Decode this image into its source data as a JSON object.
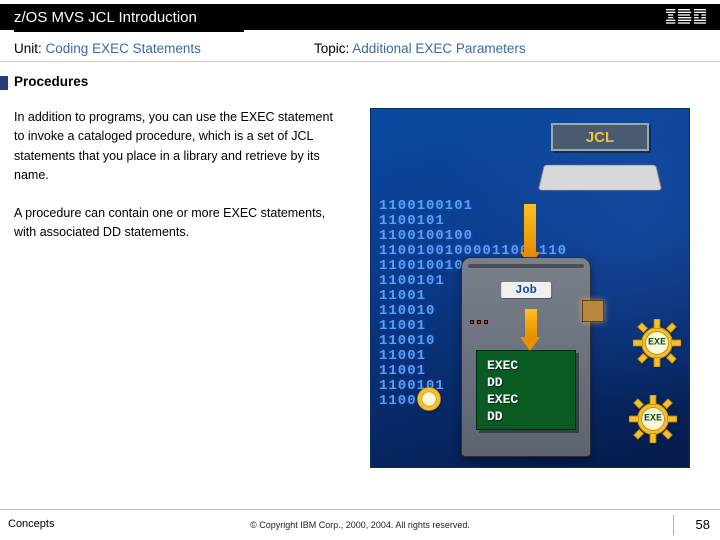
{
  "header": {
    "title": "z/OS MVS JCL Introduction",
    "logo": "IBM"
  },
  "meta": {
    "unit_label": "Unit:",
    "unit_value": "Coding EXEC Statements",
    "topic_label": "Topic:",
    "topic_value": "Additional EXEC Parameters"
  },
  "section": {
    "heading": "Procedures",
    "para1": "In addition to programs, you can use the EXEC statement to invoke a cataloged procedure, which is a set of JCL statements that you place in a library and retrieve by its name.",
    "para2": "A procedure can contain one or more EXEC statements, with associated DD statements."
  },
  "illus": {
    "jcl": "JCL",
    "job": "Job",
    "lines": [
      "EXEC",
      "DD",
      "EXEC",
      "DD"
    ],
    "gear": "EXE",
    "bits": "1100100101\n1100101\n1100100100\n11001001000011001110\n1100100100  01110110\n1100101       111010\n11001         111010\n110010\n11001\n110010\n11001\n11001\n1100101\n1100"
  },
  "footer": {
    "left": "Concepts",
    "center": "© Copyright IBM Corp., 2000, 2004. All rights reserved.",
    "page": "58"
  }
}
